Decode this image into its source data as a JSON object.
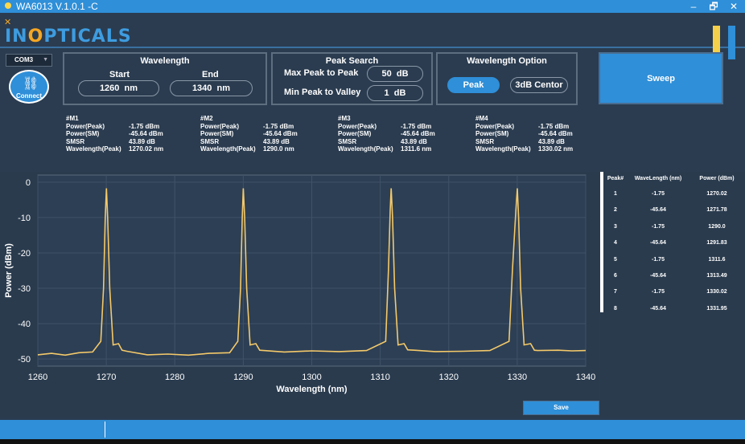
{
  "window": {
    "title": "WA6013 V.1.0.1 -C",
    "minimize": "–",
    "restore": "🗗",
    "close": "✕"
  },
  "brand": {
    "logo_prefix": "IN",
    "logo_o": "O",
    "logo_suffix": "PTICALS",
    "accent": "#f5a623",
    "primary": "#3e9ce0"
  },
  "connection": {
    "port": "COM3",
    "connect_label": "Connect"
  },
  "wavelength": {
    "title": "Wavelength",
    "start_label": "Start",
    "end_label": "End",
    "start_value": "1260",
    "end_value": "1340",
    "unit": "nm"
  },
  "peak_search": {
    "title": "Peak Search",
    "max_label": "Max Peak to Peak",
    "min_label": "Min Peak to Valley",
    "max_value": "50",
    "min_value": "1",
    "unit": "dB"
  },
  "wavelength_option": {
    "title": "Wavelength Option",
    "options": [
      "Peak",
      "3dB Centor"
    ],
    "selected": "Peak"
  },
  "sweep_label": "Sweep",
  "markers": [
    {
      "name": "#M1",
      "power_peak": "-1.75 dBm",
      "power_sm": "-45.64 dBm",
      "smsr": "43.89 dB",
      "wavelength_peak": "1270.02 nm"
    },
    {
      "name": "#M2",
      "power_peak": "-1.75 dBm",
      "power_sm": "-45.64 dBm",
      "smsr": "43.89 dB",
      "wavelength_peak": "1290.0 nm"
    },
    {
      "name": "#M3",
      "power_peak": "-1.75 dBm",
      "power_sm": "-45.64 dBm",
      "smsr": "43.89 dB",
      "wavelength_peak": "1311.6 nm"
    },
    {
      "name": "#M4",
      "power_peak": "-1.75 dBm",
      "power_sm": "-45.64 dBm",
      "smsr": "43.89 dB",
      "wavelength_peak": "1330.02 nm"
    }
  ],
  "marker_labels": {
    "power_peak": "Power(Peak)",
    "power_sm": "Power(SM)",
    "smsr": "SMSR",
    "wavelength_peak": "Wavelength(Peak)"
  },
  "peak_table": {
    "headers": [
      "Peak#",
      "WaveLength (nm)",
      "Power (dBm)"
    ],
    "rows": [
      [
        "1",
        "-1.75",
        "1270.02"
      ],
      [
        "2",
        "-45.64",
        "1271.78"
      ],
      [
        "3",
        "-1.75",
        "1290.0"
      ],
      [
        "4",
        "-45.64",
        "1291.83"
      ],
      [
        "5",
        "-1.75",
        "1311.6"
      ],
      [
        "6",
        "-45.64",
        "1313.49"
      ],
      [
        "7",
        "-1.75",
        "1330.02"
      ],
      [
        "8",
        "-45.64",
        "1331.95"
      ]
    ]
  },
  "save_label": "Save",
  "chart_data": {
    "type": "line",
    "xlabel": "Wavelength (nm)",
    "ylabel": "Power (dBm)",
    "xlim": [
      1260,
      1340
    ],
    "ylim": [
      -52,
      2
    ],
    "xticks": [
      1260,
      1270,
      1280,
      1290,
      1300,
      1310,
      1320,
      1330,
      1340
    ],
    "yticks": [
      0,
      -10,
      -20,
      -30,
      -40,
      -50
    ],
    "grid": true,
    "line_color": "#f4c96a",
    "series": [
      {
        "x": [
          1260,
          1262,
          1264,
          1266,
          1268,
          1269.2,
          1269.6,
          1269.85,
          1270.02,
          1270.2,
          1270.5,
          1271,
          1271.78,
          1272.3,
          1273,
          1276,
          1279,
          1282,
          1285,
          1288,
          1289.2,
          1289.6,
          1289.85,
          1290.0,
          1290.2,
          1290.5,
          1291,
          1291.83,
          1292.4,
          1293,
          1296,
          1300,
          1304,
          1308,
          1310.8,
          1311.2,
          1311.45,
          1311.6,
          1311.8,
          1312.1,
          1312.6,
          1313.49,
          1314,
          1315,
          1318,
          1322,
          1326,
          1328.8,
          1329.3,
          1329.8,
          1330.02,
          1330.2,
          1330.5,
          1331,
          1331.95,
          1332.5,
          1333,
          1336,
          1338,
          1340
        ],
        "y": [
          -48.8,
          -48.4,
          -48.9,
          -48.2,
          -48,
          -45,
          -30,
          -10,
          -1.75,
          -10,
          -30,
          -46,
          -45.64,
          -47.5,
          -47.8,
          -48.8,
          -48.6,
          -48.9,
          -48.4,
          -48.2,
          -45,
          -30,
          -10,
          -1.75,
          -10,
          -30,
          -46,
          -45.64,
          -47.5,
          -47.6,
          -48,
          -47.7,
          -47.9,
          -47.6,
          -45,
          -25,
          -8,
          -1.75,
          -10,
          -30,
          -46,
          -45.64,
          -47.4,
          -47.5,
          -47.9,
          -47.8,
          -47.6,
          -45,
          -25,
          -8,
          -1.75,
          -10,
          -30,
          -46,
          -45.64,
          -47.5,
          -47.6,
          -47.5,
          -47.7,
          -47.6
        ]
      }
    ]
  }
}
